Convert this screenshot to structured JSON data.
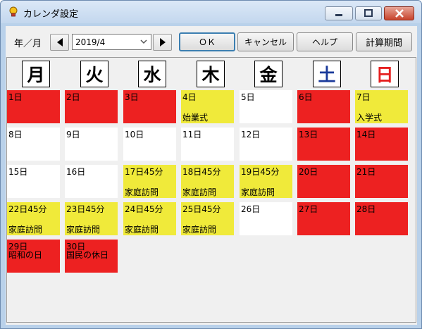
{
  "window": {
    "title": "カレンダ設定",
    "app_icon": "lightbulb-icon"
  },
  "toolbar": {
    "year_month_label": "年／月",
    "month_value": "2019/4",
    "ok_label": "ＯＫ",
    "cancel_label": "キャンセル",
    "help_label": "ヘルプ",
    "calc_label": "計算期間"
  },
  "colors": {
    "holiday": "#ed2121",
    "event": "#f0ea3a",
    "normal": "#ffffff",
    "saturday": "#1a3a9a",
    "sunday": "#e52020"
  },
  "weekdays": [
    "月",
    "火",
    "水",
    "木",
    "金",
    "土",
    "日"
  ],
  "weeks": [
    [
      {
        "num": "1日",
        "event": "",
        "type": "red"
      },
      {
        "num": "2日",
        "event": "",
        "type": "red"
      },
      {
        "num": "3日",
        "event": "",
        "type": "red"
      },
      {
        "num": "4日",
        "event": "始業式",
        "type": "yellow"
      },
      {
        "num": "5日",
        "event": "",
        "type": "white"
      },
      {
        "num": "6日",
        "event": "",
        "type": "red"
      },
      {
        "num": "7日",
        "event": "入学式",
        "type": "yellow"
      }
    ],
    [
      {
        "num": "8日",
        "event": "",
        "type": "white"
      },
      {
        "num": "9日",
        "event": "",
        "type": "white"
      },
      {
        "num": "10日",
        "event": "",
        "type": "white"
      },
      {
        "num": "11日",
        "event": "",
        "type": "white"
      },
      {
        "num": "12日",
        "event": "",
        "type": "white"
      },
      {
        "num": "13日",
        "event": "",
        "type": "red"
      },
      {
        "num": "14日",
        "event": "",
        "type": "red"
      }
    ],
    [
      {
        "num": "15日",
        "event": "",
        "type": "white"
      },
      {
        "num": "16日",
        "event": "",
        "type": "white"
      },
      {
        "num": "17日45分",
        "event": "家庭訪問",
        "type": "yellow"
      },
      {
        "num": "18日45分",
        "event": "家庭訪問",
        "type": "yellow"
      },
      {
        "num": "19日45分",
        "event": "家庭訪問",
        "type": "yellow"
      },
      {
        "num": "20日",
        "event": "",
        "type": "red"
      },
      {
        "num": "21日",
        "event": "",
        "type": "red"
      }
    ],
    [
      {
        "num": "22日45分",
        "event": "家庭訪問",
        "type": "yellow"
      },
      {
        "num": "23日45分",
        "event": "家庭訪問",
        "type": "yellow"
      },
      {
        "num": "24日45分",
        "event": "家庭訪問",
        "type": "yellow"
      },
      {
        "num": "25日45分",
        "event": "家庭訪問",
        "type": "yellow"
      },
      {
        "num": "26日",
        "event": "",
        "type": "white"
      },
      {
        "num": "27日",
        "event": "",
        "type": "red"
      },
      {
        "num": "28日",
        "event": "",
        "type": "red"
      }
    ],
    [
      {
        "num": "29日",
        "event": "昭和の日",
        "type": "red"
      },
      {
        "num": "30日",
        "event": "国民の休日",
        "type": "red"
      }
    ]
  ]
}
